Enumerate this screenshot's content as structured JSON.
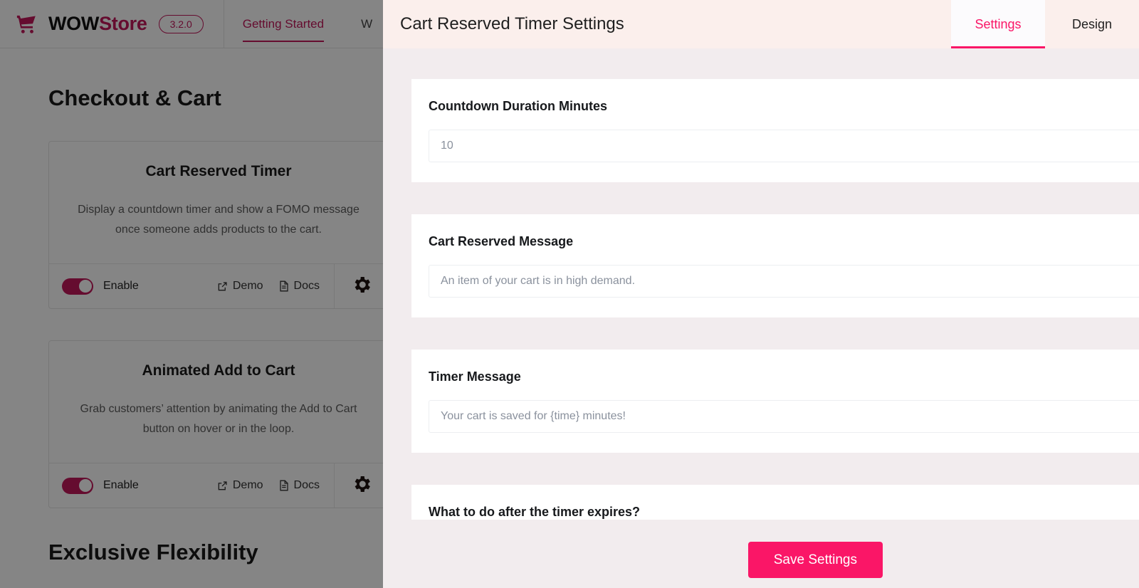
{
  "background": {
    "brand": {
      "logo_icon": "shopping-cart-icon",
      "name_part1": "WOW",
      "name_part2": "Store",
      "version": "3.2.0",
      "accent_color": "#c2185b"
    },
    "nav": [
      {
        "label": "Getting Started",
        "active": true
      },
      {
        "label": "W",
        "active": false
      }
    ],
    "page_title": "Checkout & Cart",
    "modules": [
      {
        "title": "Cart Reserved Timer",
        "description": "Display a countdown timer and show a FOMO message once someone adds products to the cart.",
        "toggle_label": "Enable",
        "toggle_on": true,
        "demo_label": "Demo",
        "demo_icon": "external-link-icon",
        "docs_label": "Docs",
        "docs_icon": "document-icon",
        "settings_icon": "gear-icon"
      },
      {
        "title": "Animated Add to Cart",
        "description": "Grab customers’ attention by animating the Add to Cart button on hover or in the loop.",
        "toggle_label": "Enable",
        "toggle_on": true,
        "demo_label": "Demo",
        "demo_icon": "external-link-icon",
        "docs_label": "Docs",
        "docs_icon": "document-icon",
        "settings_icon": "gear-icon"
      }
    ],
    "next_section_title": "Exclusive Flexibility"
  },
  "panel": {
    "title": "Cart Reserved Timer Settings",
    "tabs": [
      {
        "label": "Settings",
        "active": true
      },
      {
        "label": "Design",
        "active": false
      }
    ],
    "accent_color": "#fa1667",
    "fields": [
      {
        "label": "Countdown Duration Minutes",
        "value": "",
        "placeholder": "10"
      },
      {
        "label": "Cart Reserved Message",
        "value": "",
        "placeholder": "An item of your cart is in high demand."
      },
      {
        "label": "Timer Message",
        "value": "",
        "placeholder": "Your cart is saved for {time} minutes!"
      },
      {
        "label": "What to do after the timer expires?",
        "value": "",
        "placeholder": ""
      }
    ],
    "save_label": "Save Settings"
  }
}
